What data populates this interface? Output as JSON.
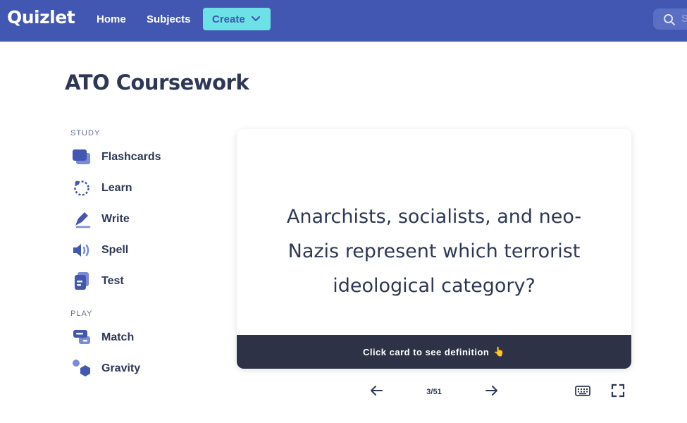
{
  "header": {
    "logo": "Quizlet",
    "nav": {
      "home": "Home",
      "subjects": "Subjects"
    },
    "create_label": "Create",
    "search_placeholder": "S"
  },
  "page": {
    "title": "ATO Coursework"
  },
  "sidebar": {
    "study_label": "STUDY",
    "study_items": [
      {
        "label": "Flashcards",
        "icon": "flashcards-icon"
      },
      {
        "label": "Learn",
        "icon": "learn-icon"
      },
      {
        "label": "Write",
        "icon": "write-icon"
      },
      {
        "label": "Spell",
        "icon": "spell-icon"
      },
      {
        "label": "Test",
        "icon": "test-icon"
      }
    ],
    "play_label": "PLAY",
    "play_items": [
      {
        "label": "Match",
        "icon": "match-icon"
      },
      {
        "label": "Gravity",
        "icon": "gravity-icon"
      }
    ]
  },
  "card": {
    "term": "Anarchists, socialists, and neo-Nazis represent which terrorist ideological category?",
    "footer_hint": "Click card to see definition",
    "hand_emoji": "👆"
  },
  "controls": {
    "counter": "3/51"
  },
  "colors": {
    "header": "#4257b2",
    "create": "#6ce2e6",
    "text": "#2e3856",
    "footer": "#2e3246",
    "icon": "#4257b2"
  }
}
